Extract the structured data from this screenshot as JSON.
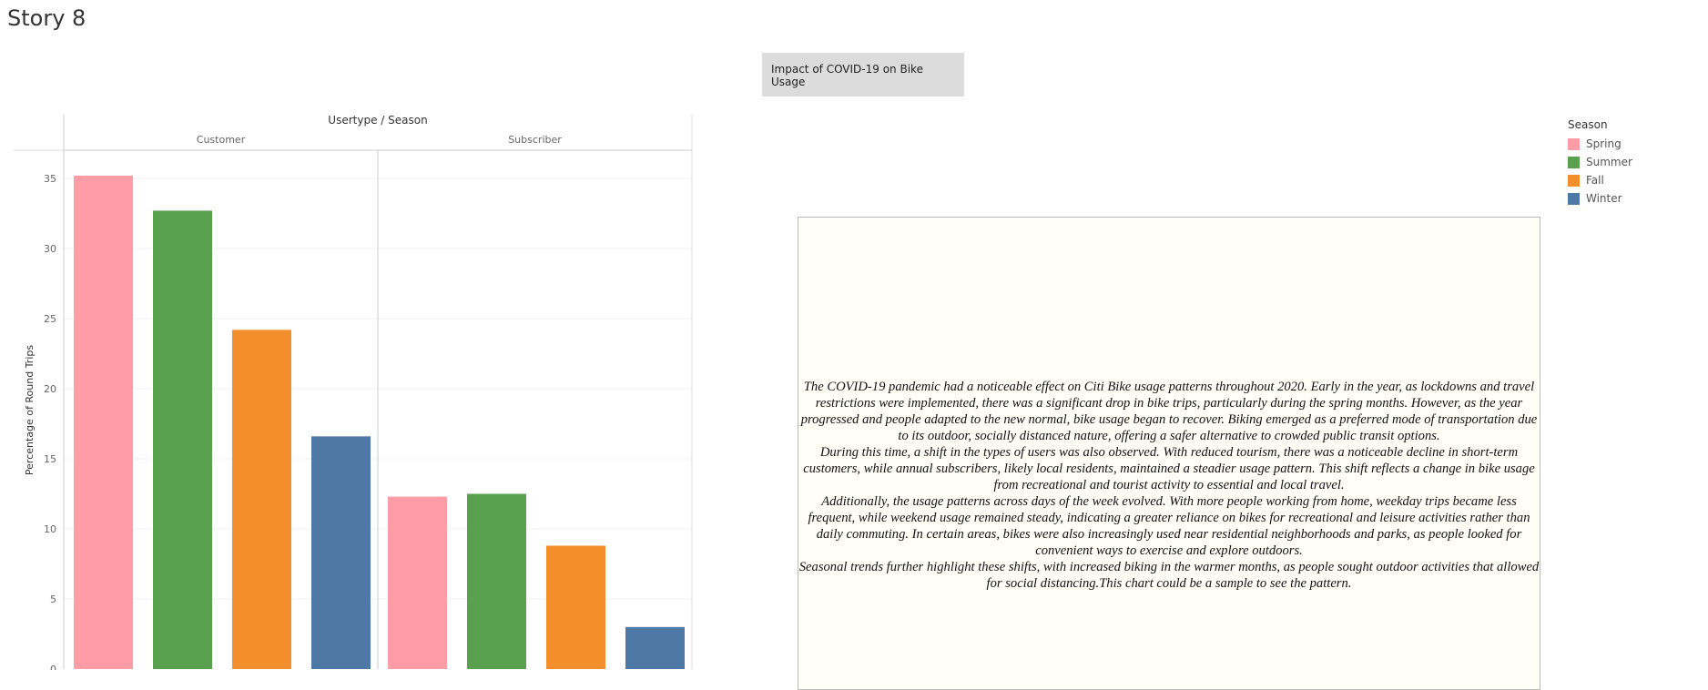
{
  "story": {
    "title": "Story 8",
    "tab_label": "Impact of COVID-19 on Bike Usage"
  },
  "legend": {
    "title": "Season",
    "items": [
      {
        "label": "Spring",
        "color": "#ff9da7"
      },
      {
        "label": "Summer",
        "color": "#59a14f"
      },
      {
        "label": "Fall",
        "color": "#f28e2b"
      },
      {
        "label": "Winter",
        "color": "#4e79a7"
      }
    ]
  },
  "textbox": {
    "paragraphs": [
      "The COVID-19 pandemic had a noticeable effect on Citi Bike usage patterns throughout 2020. Early in the year, as lockdowns and travel restrictions were implemented, there was a significant drop in bike trips, particularly during the spring months. However, as the year progressed and people adapted to the new normal, bike usage began to recover. Biking emerged as a preferred mode of transportation due to its outdoor, socially distanced nature, offering a safer alternative to crowded public transit options.",
      "During this time, a shift in the types of users was also observed. With reduced tourism, there was a noticeable decline in short-term customers, while annual subscribers, likely local residents, maintained a steadier usage pattern. This shift reflects a change in bike usage from recreational and tourist activity to essential and local travel.",
      "Additionally, the usage patterns across days of the week evolved. With more people working from home, weekday trips became less frequent, while weekend usage remained steady, indicating a greater reliance on bikes for recreational and leisure activities rather than daily commuting. In certain areas, bikes were also increasingly used near residential neighborhoods and parks, as people looked for convenient ways to exercise and explore outdoors.",
      "Seasonal trends further highlight these shifts, with increased biking in the warmer months, as people sought outdoor activities that allowed for social distancing.This chart could be a sample to see the pattern."
    ]
  },
  "chart_data": {
    "type": "bar",
    "title": "",
    "column_header": "Usertype / Season",
    "ylabel": "Percentage of Round Trips",
    "xlabel": "",
    "ylim": [
      0,
      35
    ],
    "yticks": [
      0,
      5,
      10,
      15,
      20,
      25,
      30,
      35
    ],
    "grid": true,
    "legend_position": "top-right",
    "groups": [
      {
        "name": "Customer",
        "seasons": [
          "Spring",
          "Summer",
          "Fall",
          "Winter"
        ],
        "values": [
          35.2,
          32.7,
          24.2,
          16.6
        ]
      },
      {
        "name": "Subscriber",
        "seasons": [
          "Spring",
          "Summer",
          "Fall",
          "Winter"
        ],
        "values": [
          12.3,
          12.5,
          8.8,
          3.0
        ]
      }
    ]
  }
}
